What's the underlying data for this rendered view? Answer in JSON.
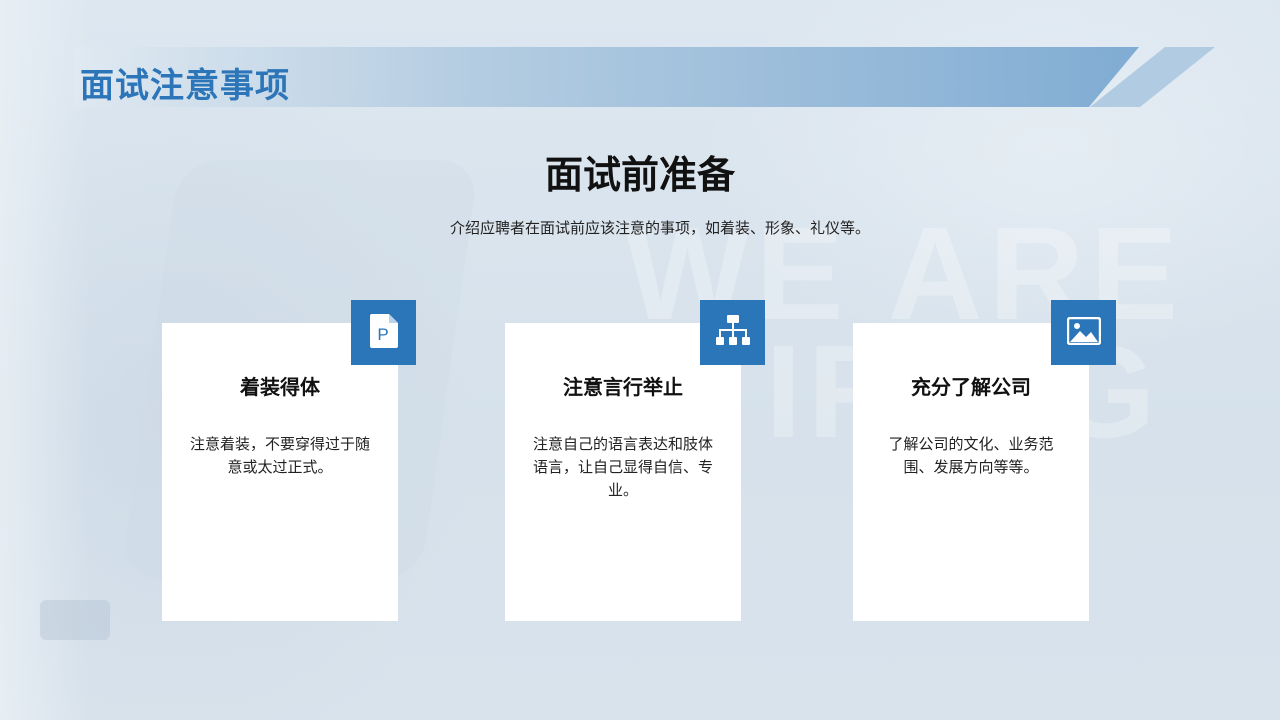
{
  "header": {
    "title": "面试注意事项"
  },
  "main": {
    "heading": "面试前准备",
    "subtitle": "介绍应聘者在面试前应该注意的事项，如着装、形象、礼仪等。"
  },
  "background": {
    "watermark_line_1": "WE ARE",
    "watermark_line_2": "IRING"
  },
  "cards": [
    {
      "icon": "document-p-icon",
      "title": "着装得体",
      "text": "注意着装，不要穿得过于随意或太过正式。"
    },
    {
      "icon": "org-chart-icon",
      "title": "注意言行举止",
      "text": "注意自己的语言表达和肢体语言，让自己显得自信、专业。"
    },
    {
      "icon": "image-icon",
      "title": "充分了解公司",
      "text": "了解公司的文化、业务范围、发展方向等等。"
    }
  ],
  "colors": {
    "accent": "#2a76b9",
    "title": "#2c75b8",
    "background": "#dce6ef",
    "card": "#ffffff"
  }
}
